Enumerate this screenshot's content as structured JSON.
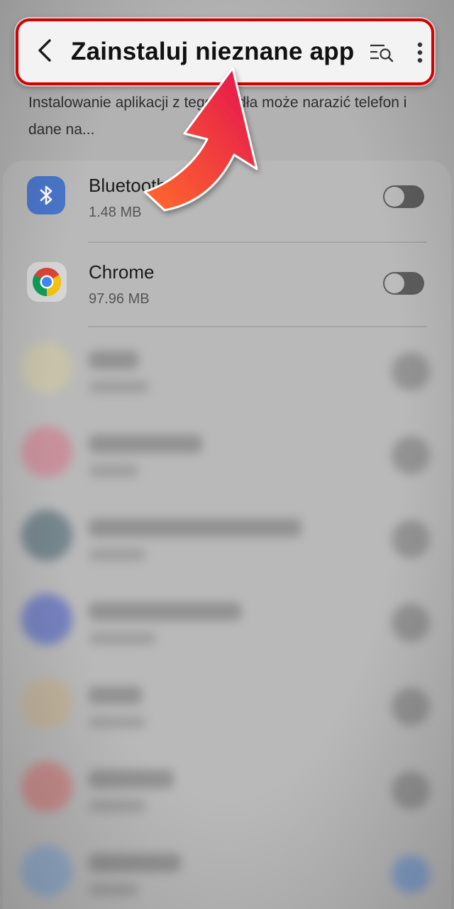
{
  "header": {
    "title": "Zainstaluj nieznane app",
    "back_icon": "back-arrow-icon",
    "search_icon": "search-list-icon",
    "more_icon": "more-vertical-icon"
  },
  "description": {
    "text": "Instalowanie aplikacji z tego źródła może narazić telefon i dane na..."
  },
  "apps": [
    {
      "name": "Bluetooth",
      "size": "1.48 MB",
      "icon": "bluetooth-icon",
      "enabled": false
    },
    {
      "name": "Chrome",
      "size": "97.96 MB",
      "icon": "chrome-icon",
      "enabled": false
    }
  ],
  "colors": {
    "highlight_border": "#d40000",
    "arrow_gradient_start": "#ff6b2b",
    "arrow_gradient_end": "#e3124f",
    "bluetooth_bg": "#4a76c9"
  }
}
